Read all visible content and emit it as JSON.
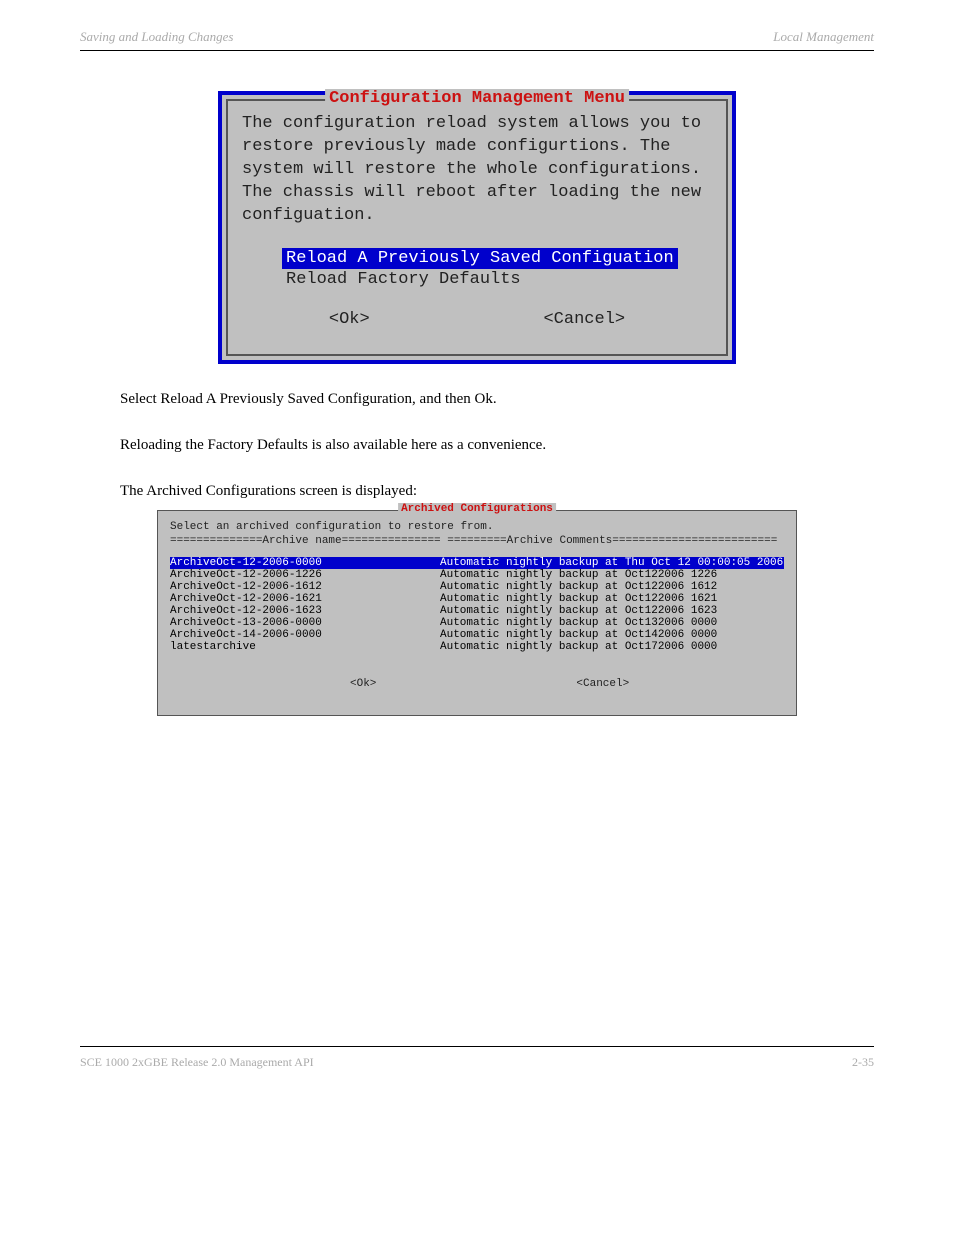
{
  "header": {
    "left": "Saving and Loading Changes",
    "right": "Local Management"
  },
  "screenshot1": {
    "title": "Configuration Management Menu",
    "description": "The configuration reload system allows you to restore previously made configurtions. The system will restore the whole configurations. The chassis will reboot after loading the new configuation.",
    "items": [
      {
        "label": "Reload A Previously Saved Configuation",
        "selected": true
      },
      {
        "label": "Reload Factory Defaults",
        "selected": false
      }
    ],
    "ok": "<Ok>",
    "cancel": "<Cancel>"
  },
  "body": {
    "p1": "Select Reload A Previously Saved Configuration, and then Ok.",
    "p2": "Reloading the Factory Defaults is also available here as a convenience.",
    "p3": "The Archived Configurations screen is displayed:"
  },
  "screenshot2": {
    "title": "Archived Configurations",
    "desc": "Select an archived configuration to restore from.",
    "header_label": "==============Archive name=============== =========Archive Comments=========================",
    "rows": [
      {
        "name": "ArchiveOct-12-2006-0000",
        "comment": "Automatic nightly backup at Thu Oct 12 00:00:05 2006",
        "selected": true
      },
      {
        "name": "ArchiveOct-12-2006-1226",
        "comment": "Automatic nightly backup at Oct122006 1226",
        "selected": false
      },
      {
        "name": "ArchiveOct-12-2006-1612",
        "comment": "Automatic nightly backup at Oct122006 1612",
        "selected": false
      },
      {
        "name": "ArchiveOct-12-2006-1621",
        "comment": "Automatic nightly backup at Oct122006 1621",
        "selected": false
      },
      {
        "name": "ArchiveOct-12-2006-1623",
        "comment": "Automatic nightly backup at Oct122006 1623",
        "selected": false
      },
      {
        "name": "ArchiveOct-13-2006-0000",
        "comment": "Automatic nightly backup at Oct132006 0000",
        "selected": false
      },
      {
        "name": "ArchiveOct-14-2006-0000",
        "comment": "Automatic nightly backup at Oct142006 0000",
        "selected": false
      },
      {
        "name": "latestarchive",
        "comment": "Automatic nightly backup at Oct172006 0000",
        "selected": false
      }
    ],
    "ok": "<Ok>",
    "cancel": "<Cancel>"
  },
  "footer": {
    "left": "SCE 1000 2xGBE Release 2.0 Management API",
    "right": "2-35"
  }
}
